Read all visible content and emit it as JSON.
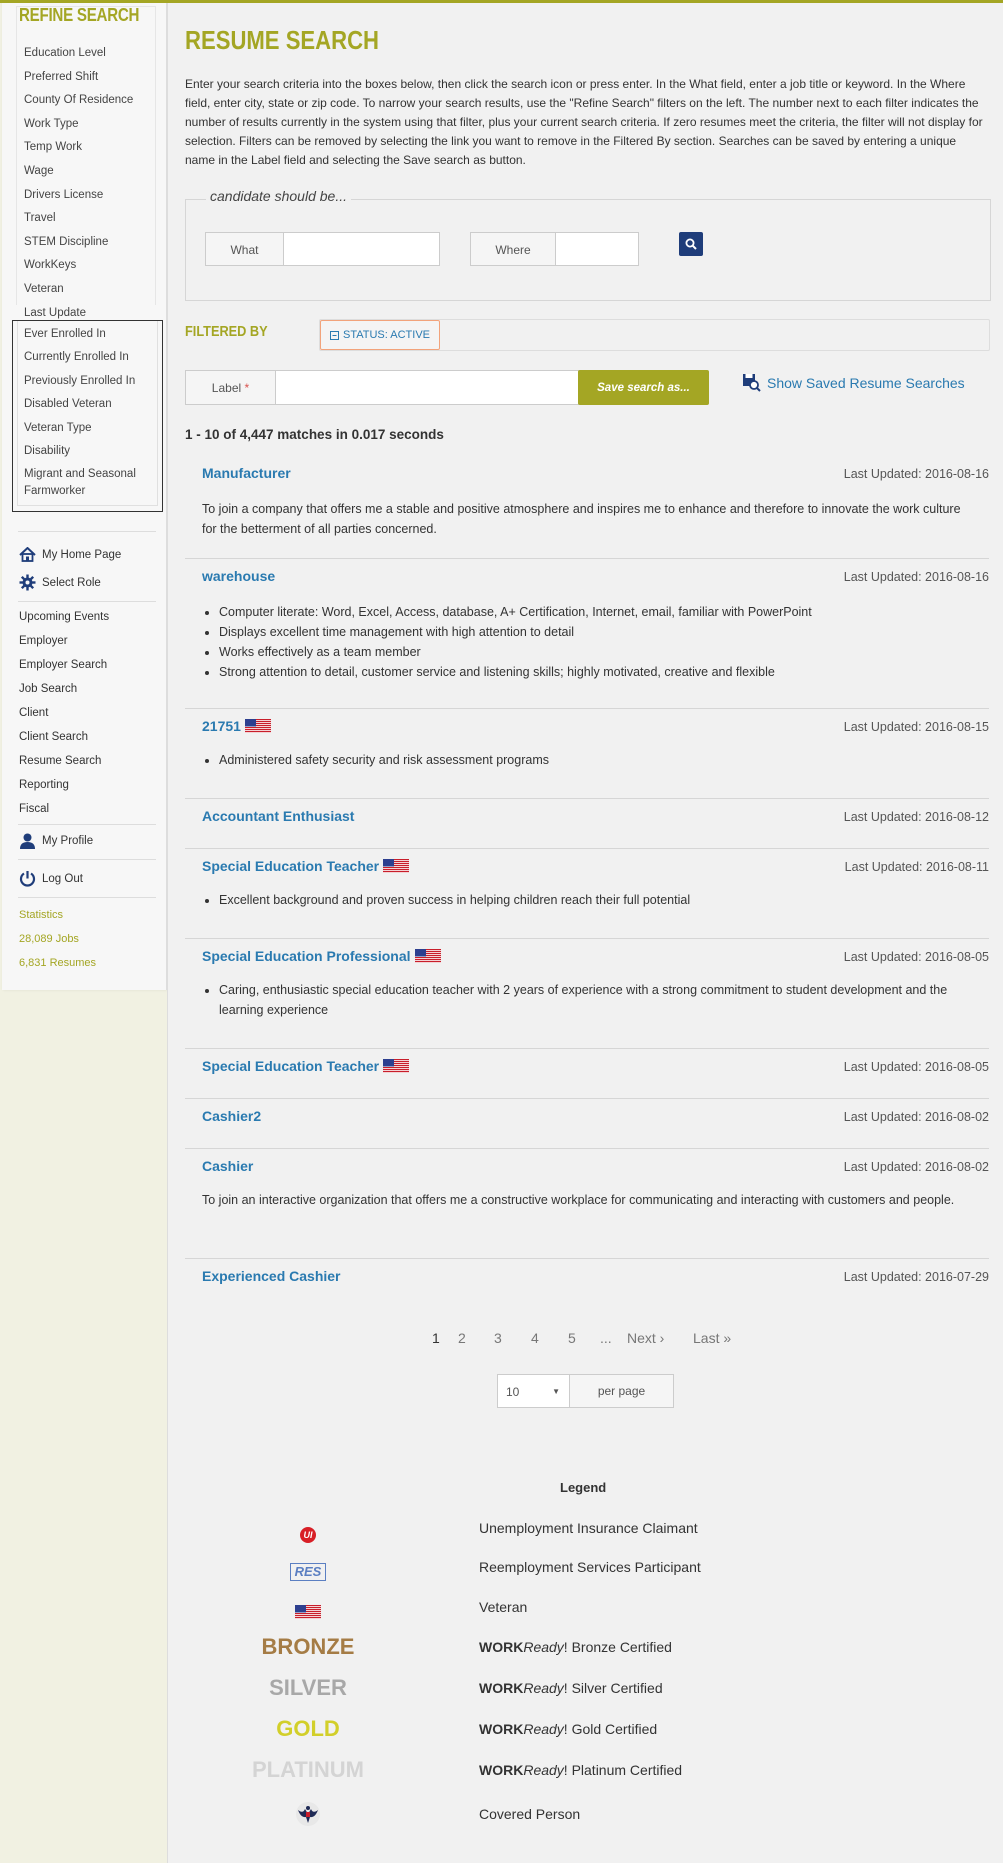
{
  "sidebar": {
    "refine_title": "REFINE SEARCH",
    "refine_items": [
      "Education Level",
      "Preferred Shift",
      "County Of Residence",
      "Work Type",
      "Temp Work",
      "Wage",
      "Drivers License",
      "Travel",
      "STEM Discipline",
      "WorkKeys",
      "Veteran",
      "Last Update"
    ],
    "enrolled_items": [
      "Ever Enrolled In",
      "Currently Enrolled In",
      "Previously Enrolled In",
      "Disabled Veteran",
      "Veteran Type",
      "Disability",
      "Migrant and Seasonal",
      "Farmworker"
    ],
    "home": "My Home Page",
    "role": "Select Role",
    "nav": [
      "Upcoming Events",
      "Employer",
      "Employer Search",
      "Job Search",
      "Client",
      "Client Search",
      "Resume Search",
      "Reporting",
      "Fiscal"
    ],
    "profile": "My Profile",
    "logout": "Log Out",
    "stats": [
      "Statistics",
      "28,089 Jobs",
      "6,831 Resumes"
    ]
  },
  "main": {
    "title": "RESUME SEARCH",
    "intro": "Enter your search criteria into the boxes below, then click the search icon or press enter. In the What field, enter a job title or keyword. In the Where field, enter city, state or zip code. To narrow your search results, use the \"Refine Search\" filters on the left. The number next to each filter indicates the number of results currently in the system using that filter, plus your current search criteria. If zero resumes meet the criteria, the filter will not display for selection. Filters can be removed by selecting the link you want to remove in the Filtered By section. Searches can be saved by entering a unique name in the Label field and selecting the Save search as button.",
    "fieldset_legend": "candidate should be...",
    "what_label": "What",
    "what_value": "",
    "where_label": "Where",
    "where_value": "",
    "filtered_by": "FILTERED BY",
    "filter_chip": "STATUS: ACTIVE",
    "label_text": "Label",
    "label_required": "*",
    "label_value": "",
    "save_button": "Save search as...",
    "saved_link": "Show Saved Resume Searches",
    "result_count": "1 - 10 of 4,447 matches in 0.017 seconds"
  },
  "results": [
    {
      "title": "Manufacturer",
      "veteran": false,
      "date": "Last Updated: 2016-08-16",
      "para": "To join a company that offers me a stable and positive atmosphere and inspires me to enhance and therefore to innovate the work culture for the betterment of all parties concerned.",
      "bullets": []
    },
    {
      "title": "warehouse",
      "veteran": false,
      "date": "Last Updated: 2016-08-16",
      "para": "",
      "bullets": [
        "Computer literate: Word, Excel, Access, database, A+ Certification, Internet, email, familiar with PowerPoint",
        "Displays excellent time management with high attention to detail",
        "Works effectively as a team member",
        "Strong attention to detail, customer service and listening skills; highly motivated, creative and flexible"
      ]
    },
    {
      "title": "21751",
      "veteran": true,
      "date": "Last Updated: 2016-08-15",
      "para": "",
      "bullets": [
        "Administered safety security and risk assessment programs"
      ]
    },
    {
      "title": "Accountant Enthusiast",
      "veteran": false,
      "date": "Last Updated: 2016-08-12",
      "para": "",
      "bullets": []
    },
    {
      "title": "Special Education Teacher",
      "veteran": true,
      "date": "Last Updated: 2016-08-11",
      "para": "",
      "bullets": [
        "Excellent background and proven success in helping children reach their full potential"
      ]
    },
    {
      "title": "Special Education Professional",
      "veteran": true,
      "date": "Last Updated: 2016-08-05",
      "para": "",
      "bullets": [
        "Caring, enthusiastic special education teacher with 2 years of experience with a strong commitment to student development and the learning experience"
      ]
    },
    {
      "title": "Special Education Teacher",
      "veteran": true,
      "date": "Last Updated: 2016-08-05",
      "para": "",
      "bullets": []
    },
    {
      "title": "Cashier2",
      "veteran": false,
      "date": "Last Updated: 2016-08-02",
      "para": "",
      "bullets": []
    },
    {
      "title": "Cashier",
      "veteran": false,
      "date": "Last Updated: 2016-08-02",
      "para": "To join an interactive organization that offers me a constructive workplace for communicating and interacting with customers and people.",
      "bullets": []
    },
    {
      "title": "Experienced Cashier",
      "veteran": false,
      "date": "Last Updated: 2016-07-29",
      "para": "",
      "bullets": []
    }
  ],
  "pagination": {
    "pages": [
      "1",
      "2",
      "3",
      "4",
      "5",
      "...",
      "Next ›",
      "Last »"
    ],
    "current": "1",
    "per_page_value": "10",
    "per_page_label": "per page"
  },
  "legend": {
    "title": "Legend",
    "ui_icon": "UI",
    "res_icon": "RES",
    "items": [
      {
        "icon": "ui-icon",
        "desc": "Unemployment Insurance Claimant"
      },
      {
        "icon": "res-icon",
        "desc": "Reemployment Services Participant"
      },
      {
        "icon": "flag-icon",
        "desc": "Veteran"
      },
      {
        "icon": "bronze",
        "label": "BRONZE",
        "work": "WORK",
        "ready": "Ready",
        "desc": "! Bronze Certified",
        "color": "#a57c45"
      },
      {
        "icon": "silver",
        "label": "SILVER",
        "work": "WORK",
        "ready": "Ready",
        "desc": "! Silver Certified",
        "color": "#a8a8a8"
      },
      {
        "icon": "gold",
        "label": "GOLD",
        "work": "WORK",
        "ready": "Ready",
        "desc": "! Gold Certified",
        "color": "#d2cf2a"
      },
      {
        "icon": "platinum",
        "label": "PLATINUM",
        "work": "WORK",
        "ready": "Ready",
        "desc": "! Platinum Certified",
        "color": "#d4d4d4"
      },
      {
        "icon": "eagle-icon",
        "desc": "Covered Person"
      }
    ]
  },
  "colors": {
    "accent": "#a4a624",
    "link": "#2a7ab0",
    "button_dark": "#1f3d7a"
  }
}
